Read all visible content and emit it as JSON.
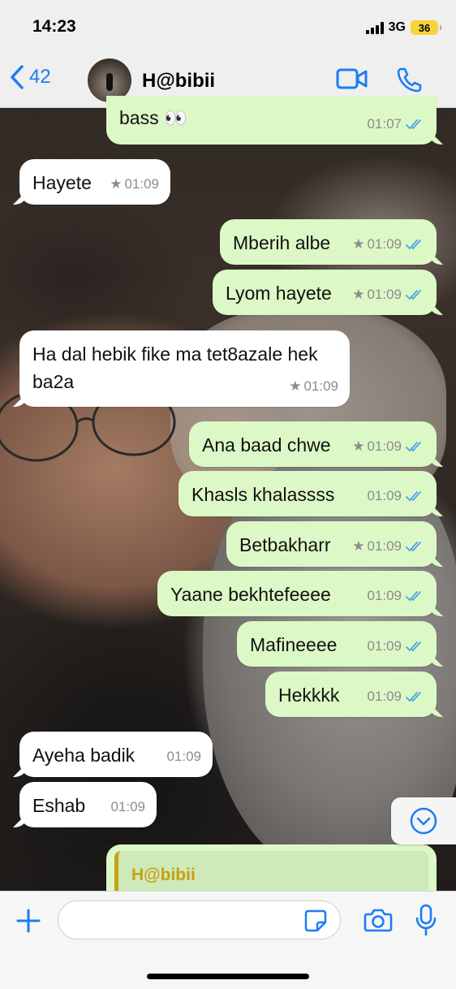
{
  "status_bar": {
    "time": "14:23",
    "network": "3G",
    "battery": "36"
  },
  "header": {
    "back_count": "42",
    "contact_name": "H@bibii"
  },
  "messages": [
    {
      "text": "bass 👀",
      "time": "01:07"
    },
    {
      "text": "Hayete",
      "time": "01:09"
    },
    {
      "text": "Mberih albe",
      "time": "01:09"
    },
    {
      "text": "Lyom hayete",
      "time": "01:09"
    },
    {
      "text": "Ha dal hebik fike ma tet8azale hek ba2a",
      "time": "01:09"
    },
    {
      "text": "Ana baad chwe",
      "time": "01:09"
    },
    {
      "text": "Khasls khalassss",
      "time": "01:09"
    },
    {
      "text": "Betbakharr",
      "time": "01:09"
    },
    {
      "text": "Yaane bekhtefeeee",
      "time": "01:09"
    },
    {
      "text": "Mafineeee",
      "time": "01:09"
    },
    {
      "text": "Hekkkk",
      "time": "01:09"
    },
    {
      "text": "Ayeha badik",
      "time": "01:09"
    },
    {
      "text": "Eshab",
      "time": "01:09"
    }
  ],
  "reply_preview": {
    "author": "H@bibii"
  },
  "input": {
    "value": "",
    "placeholder": ""
  },
  "colors": {
    "outgoing_bubble": "#dcf8c6",
    "incoming_bubble": "#ffffff",
    "accent": "#1c7cf4",
    "read_ticks": "#4fa3e8",
    "quote_author": "#c9a014"
  },
  "icons": [
    "chevron-left-icon",
    "video-call-icon",
    "phone-icon",
    "star-icon",
    "double-check-icon",
    "chevron-down-icon",
    "plus-icon",
    "sticker-icon",
    "camera-icon",
    "microphone-icon"
  ]
}
